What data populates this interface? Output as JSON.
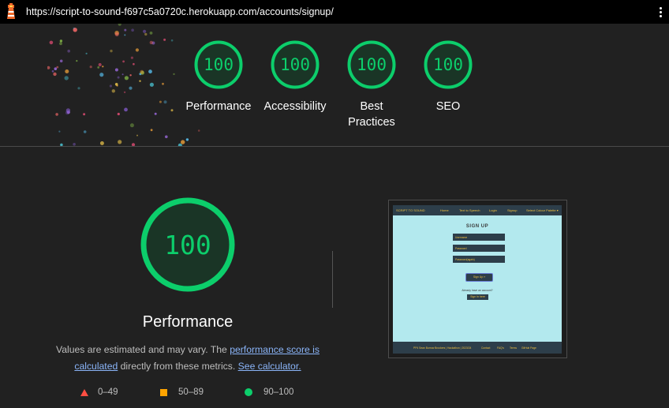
{
  "browser": {
    "url": "https://script-to-sound-f697c5a0720c.herokuapp.com/accounts/signup/"
  },
  "summary_scores": [
    {
      "label": "Performance",
      "score": "100"
    },
    {
      "label": "Accessibility",
      "score": "100"
    },
    {
      "label": "Best Practices",
      "score": "100"
    },
    {
      "label": "SEO",
      "score": "100"
    }
  ],
  "performance": {
    "score": "100",
    "title": "Performance",
    "desc_part1": "Values are estimated and may vary. The ",
    "desc_link1": "performance score is calculated",
    "desc_part2": " directly from these metrics. ",
    "desc_link2": "See calculator."
  },
  "legend": [
    {
      "range": "0–49",
      "color": "#ff4e42"
    },
    {
      "range": "50–89",
      "color": "#ffa400"
    },
    {
      "range": "90–100",
      "color": "#0cce6b"
    }
  ],
  "colors": {
    "pass": "#0cce6b",
    "pass_bg": "#1c3a28",
    "background": "#212121"
  },
  "screenshot": {
    "brand": "SCRIPT TO SOUND",
    "nav": [
      "Home",
      "Text to Speech",
      "Login",
      "Signup",
      "Select Colour Palette ▾"
    ],
    "heading": "SIGN UP",
    "fields": [
      "Username",
      "Password",
      "Password(again)"
    ],
    "signup_button": "Sign Up »",
    "already_text": "Already have an account?",
    "signin_button": "Sign In here",
    "footer": [
      "PP4 Sean Burrow Brookers | Hackathon | 2023/24",
      "Contact",
      "FAQ's",
      "Terms",
      "GitHub Page"
    ]
  }
}
